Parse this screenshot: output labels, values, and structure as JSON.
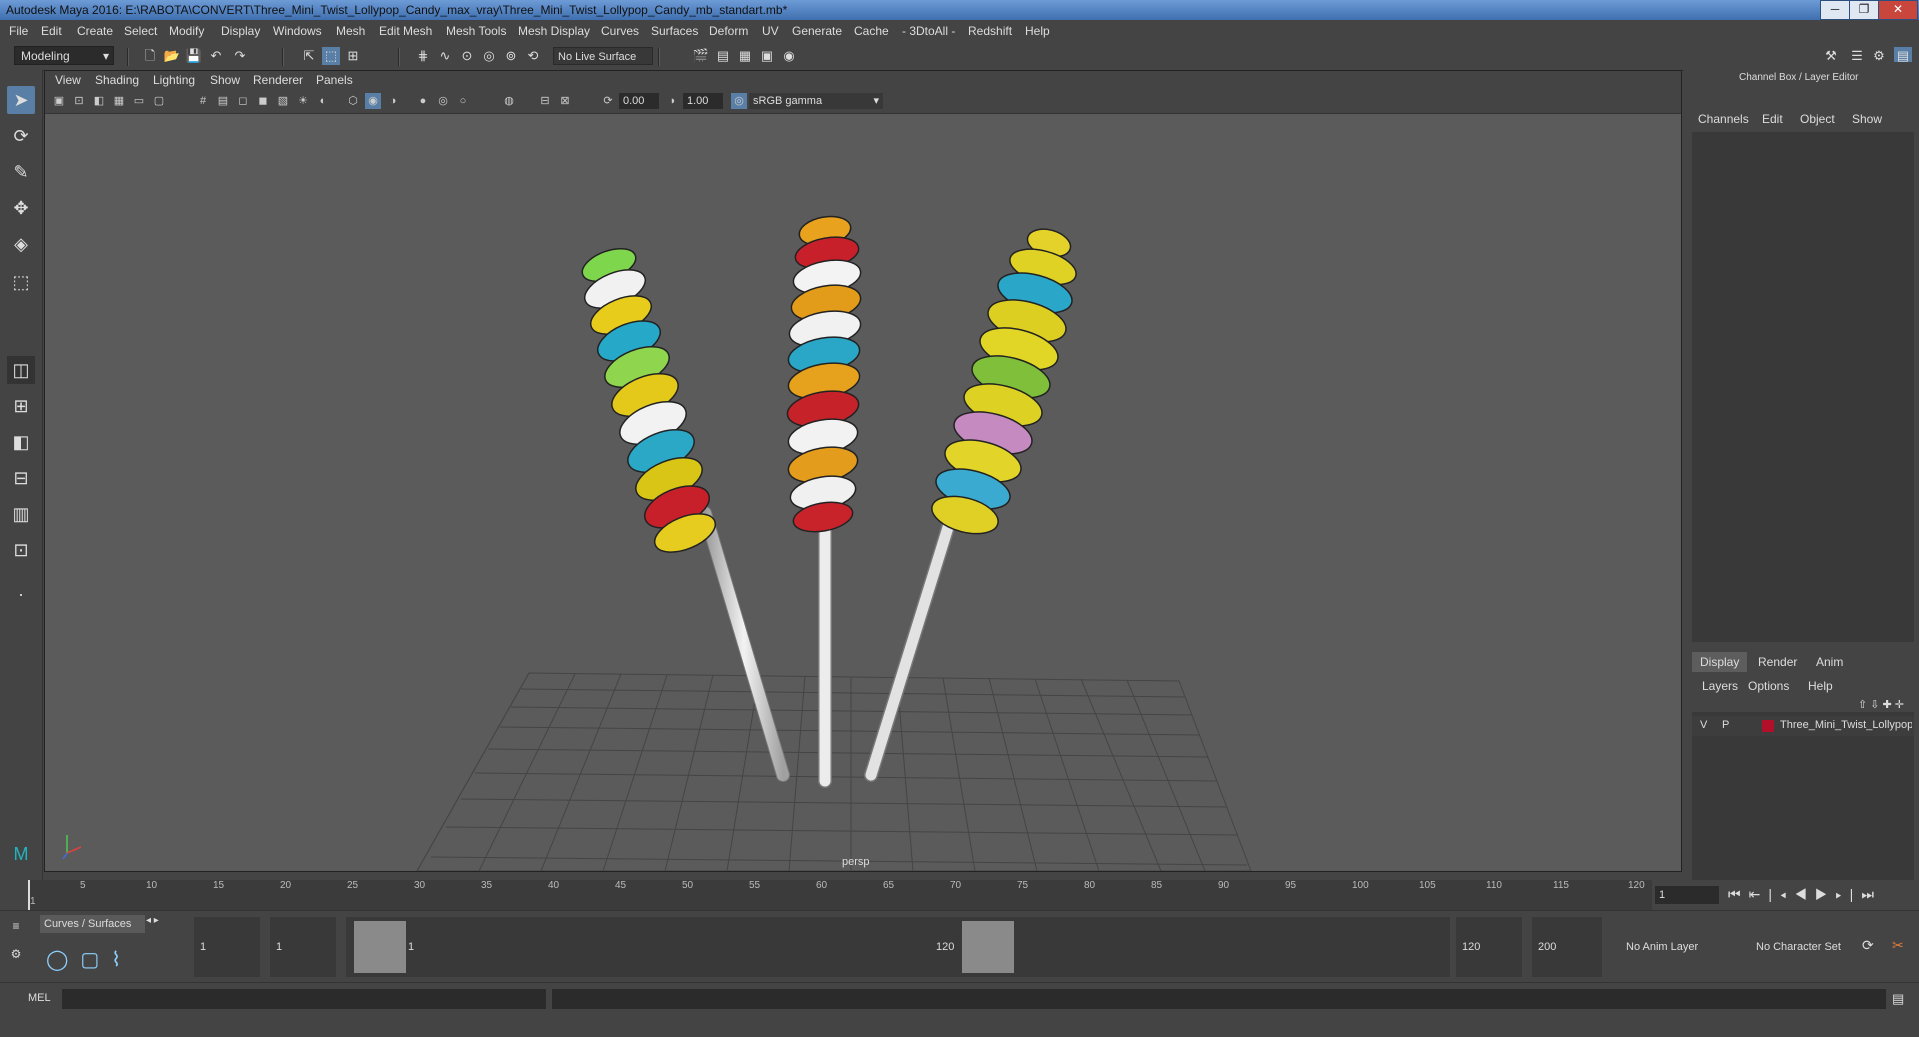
{
  "window": {
    "title": "Autodesk Maya 2016: E:\\RABOTA\\CONVERT\\Three_Mini_Twist_Lollypop_Candy_max_vray\\Three_Mini_Twist_Lollypop_Candy_mb_standart.mb*",
    "minimize": "─",
    "restore": "❐",
    "close": "✕"
  },
  "menu": [
    "File",
    "Edit",
    "Create",
    "Select",
    "Modify",
    "Display",
    "Windows",
    "Mesh",
    "Edit Mesh",
    "Mesh Tools",
    "Mesh Display",
    "Curves",
    "Surfaces",
    "Deform",
    "UV",
    "Generate",
    "Cache",
    "- 3DtoAll -",
    "Redshift",
    "Help"
  ],
  "shelf": {
    "mode": "Modeling",
    "live_surface": "No Live Surface"
  },
  "viewport": {
    "menu": [
      "View",
      "Shading",
      "Lighting",
      "Show",
      "Renderer",
      "Panels"
    ],
    "exposure": "0.00",
    "gamma": "1.00",
    "color_space": "sRGB gamma",
    "camera": "persp"
  },
  "channel_box": {
    "title": "Channel Box / Layer Editor",
    "menu": [
      "Channels",
      "Edit",
      "Object",
      "Show"
    ],
    "tabs": [
      "Display",
      "Render",
      "Anim"
    ],
    "layer_menu": [
      "Layers",
      "Options",
      "Help"
    ],
    "layer": {
      "v": "V",
      "p": "P",
      "name": "Three_Mini_Twist_Lollypop_Candy",
      "color": "#b0102a"
    }
  },
  "timeline": {
    "ticks": [
      "1",
      "5",
      "10",
      "15",
      "20",
      "25",
      "30",
      "35",
      "40",
      "45",
      "50",
      "55",
      "60",
      "65",
      "70",
      "75",
      "80",
      "85",
      "90",
      "95",
      "100",
      "105",
      "110",
      "115",
      "120"
    ],
    "current_frame": "1"
  },
  "range": {
    "shelf_tab": "Curves / Surfaces",
    "start": "1",
    "playback_start": "1",
    "slider_start": "1",
    "slider_end": "120",
    "playback_end": "120",
    "end": "200",
    "anim_layer": "No Anim Layer",
    "character_set": "No Character Set"
  },
  "command": {
    "label": "MEL"
  }
}
